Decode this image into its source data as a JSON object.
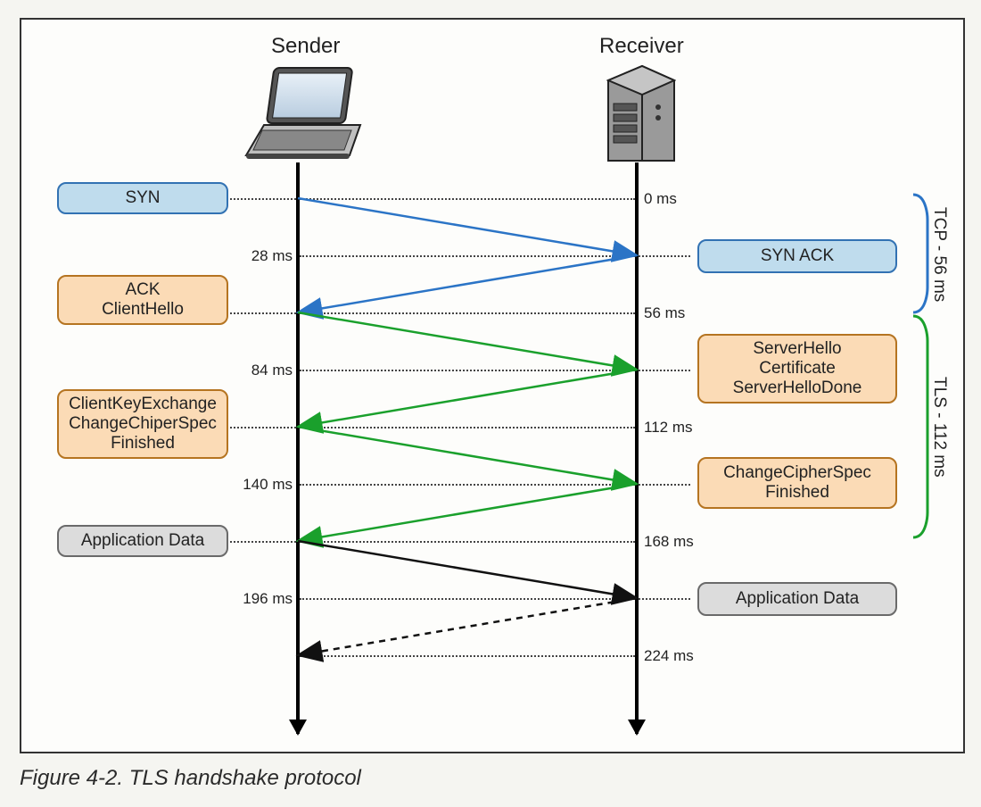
{
  "caption": "Figure 4-2. TLS handshake protocol",
  "actors": {
    "sender": "Sender",
    "receiver": "Receiver"
  },
  "times": {
    "t0": "0 ms",
    "t28": "28 ms",
    "t56": "56 ms",
    "t84": "84 ms",
    "t112": "112 ms",
    "t140": "140 ms",
    "t168": "168 ms",
    "t196": "196 ms",
    "t224": "224 ms"
  },
  "messages": {
    "syn": "SYN",
    "synack": "SYN ACK",
    "ack_clienthello_l1": "ACK",
    "ack_clienthello_l2": "ClientHello",
    "serverhello_l1": "ServerHello",
    "serverhello_l2": "Certificate",
    "serverhello_l3": "ServerHelloDone",
    "clientkey_l1": "ClientKeyExchange",
    "clientkey_l2": "ChangeChiperSpec",
    "clientkey_l3": "Finished",
    "changecipher_l1": "ChangeCipherSpec",
    "changecipher_l2": "Finished",
    "appdata_client": "Application Data",
    "appdata_server": "Application Data"
  },
  "phases": {
    "tcp": "TCP - 56 ms",
    "tls": "TLS - 112 ms"
  },
  "chart_data": {
    "type": "sequence-diagram",
    "title": "TLS handshake protocol",
    "participants": [
      "Sender",
      "Receiver"
    ],
    "one_way_latency_ms": 28,
    "events": [
      {
        "at_ms": 0,
        "from": "Sender",
        "to": "Receiver",
        "label": "SYN",
        "phase": "TCP",
        "style": "solid"
      },
      {
        "at_ms": 28,
        "from": "Receiver",
        "to": "Sender",
        "label": "SYN ACK",
        "phase": "TCP",
        "style": "solid"
      },
      {
        "at_ms": 56,
        "from": "Sender",
        "to": "Receiver",
        "label": "ACK + ClientHello",
        "phase": "TLS",
        "style": "solid"
      },
      {
        "at_ms": 84,
        "from": "Receiver",
        "to": "Sender",
        "label": "ServerHello + Certificate + ServerHelloDone",
        "phase": "TLS",
        "style": "solid"
      },
      {
        "at_ms": 112,
        "from": "Sender",
        "to": "Receiver",
        "label": "ClientKeyExchange + ChangeCipherSpec + Finished",
        "phase": "TLS",
        "style": "solid"
      },
      {
        "at_ms": 140,
        "from": "Receiver",
        "to": "Sender",
        "label": "ChangeCipherSpec + Finished",
        "phase": "TLS",
        "style": "solid"
      },
      {
        "at_ms": 168,
        "from": "Sender",
        "to": "Receiver",
        "label": "Application Data",
        "phase": "App",
        "style": "solid"
      },
      {
        "at_ms": 196,
        "from": "Receiver",
        "to": "Sender",
        "label": "Application Data (response)",
        "phase": "App",
        "style": "dashed"
      }
    ],
    "phase_durations_ms": {
      "TCP": 56,
      "TLS": 112
    },
    "total_ms_shown": 224
  }
}
